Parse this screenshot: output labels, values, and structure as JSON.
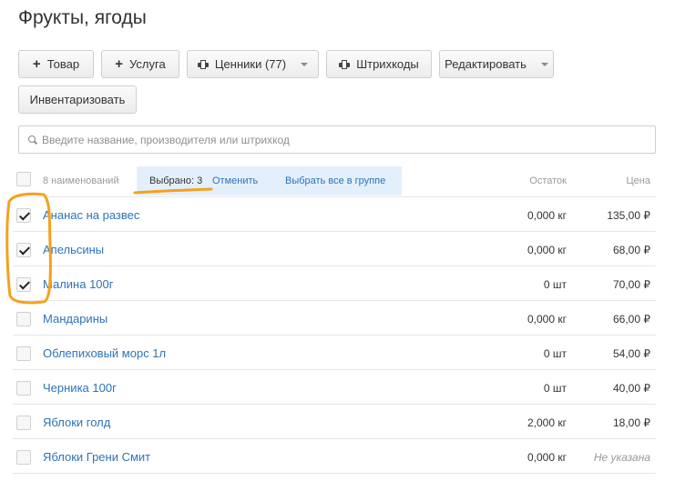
{
  "page": {
    "title": "Фрукты, ягоды"
  },
  "toolbar": {
    "product": "Товар",
    "service": "Услуга",
    "price_tags": "Ценники (77)",
    "barcodes": "Штрихкоды",
    "edit": "Редактировать",
    "inventory": "Инвентаризовать"
  },
  "search": {
    "placeholder": "Введите название, производителя или штрихкод",
    "value": ""
  },
  "list_header": {
    "count": "8 наименований",
    "selected": "Выбрано: 3",
    "cancel": "Отменить",
    "select_all": "Выбрать все в группе",
    "stock": "Остаток",
    "price": "Цена"
  },
  "rows": [
    {
      "name": "Ананас на развес",
      "stock": "0,000 кг",
      "price": "135,00 ₽",
      "checked": true
    },
    {
      "name": "Апельсины",
      "stock": "0,000 кг",
      "price": "68,00 ₽",
      "checked": true
    },
    {
      "name": "Малина 100г",
      "stock": "0 шт",
      "price": "70,00 ₽",
      "checked": true
    },
    {
      "name": "Мандарины",
      "stock": "0,000 кг",
      "price": "66,00 ₽",
      "checked": false
    },
    {
      "name": "Облепиховый морс 1л",
      "stock": "0 шт",
      "price": "54,00 ₽",
      "checked": false
    },
    {
      "name": "Черника 100г",
      "stock": "0 шт",
      "price": "40,00 ₽",
      "checked": false
    },
    {
      "name": "Яблоки голд",
      "stock": "2,000 кг",
      "price": "18,00 ₽",
      "checked": false
    },
    {
      "name": "Яблоки Грени Смит",
      "stock": "0,000 кг",
      "price": "Не указана",
      "checked": false
    }
  ],
  "colors": {
    "link": "#2f72b8",
    "selection_bar": "#e3f0fb",
    "annotation": "#f5a11c"
  }
}
